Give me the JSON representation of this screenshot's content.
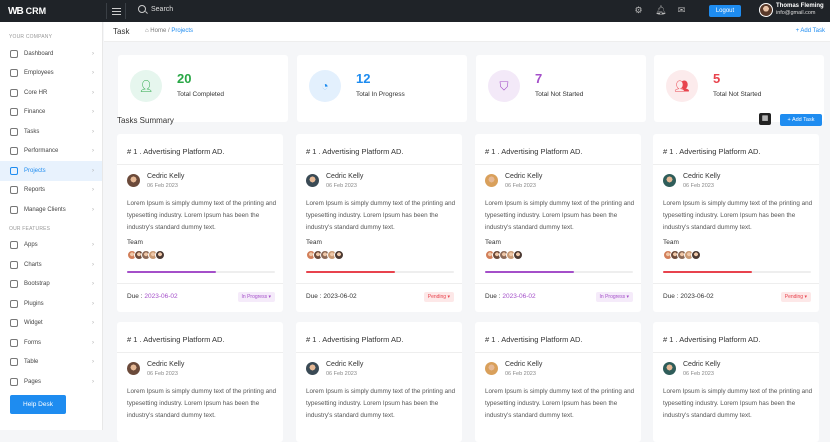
{
  "topbar": {
    "brand": "CRM",
    "brand_mark": "WB",
    "search_label": "Search",
    "logout_label": "Logout",
    "user_name": "Thomas Fleming",
    "user_email": "info@gmail.com"
  },
  "sidebar": {
    "section1": "YOUR COMPANY",
    "items1": [
      "Dashboard",
      "Employees",
      "Core HR",
      "Finance",
      "Tasks",
      "Performance",
      "Projects",
      "Reports",
      "Manage Clients"
    ],
    "section2": "OUR FEATURES",
    "items2": [
      "Apps",
      "Charts",
      "Bootstrap",
      "Plugins",
      "Widget",
      "Forms",
      "Table",
      "Pages"
    ],
    "help_label": "Help Desk"
  },
  "page": {
    "title": "Task",
    "crumb_home": "Home",
    "crumb_sep": "/",
    "crumb_current": "Projects",
    "add_task_link": "+ Add Task"
  },
  "stats": [
    {
      "value": "20",
      "label": "Total Completed",
      "color": "#28a745",
      "bg": "#e6f6ee"
    },
    {
      "value": "12",
      "label": "Total In Progress",
      "color": "#1e8cf0",
      "bg": "#e3f0fd"
    },
    {
      "value": "7",
      "label": "Total Not Started",
      "color": "#a44fc9",
      "bg": "#f3e9f8"
    },
    {
      "value": "5",
      "label": "Total Not Started",
      "color": "#e8434d",
      "bg": "#fcebec"
    }
  ],
  "summary": {
    "title": "Tasks Summary",
    "add_label": "+ Add Task"
  },
  "cards": [
    {
      "title": "# 1 . Advertising Platform AD.",
      "name": "Cedric Kelly",
      "date": "06 Feb 2023",
      "desc": "Lorem Ipsum is simply dummy text of the printing and typesetting industry. Lorem Ipsum has been the industry's standard dummy text.",
      "team": "Team",
      "due_label": "Due :",
      "due": "2023-06-02",
      "status": "In Progress",
      "progress": 0.6,
      "color": "#a44fc9"
    },
    {
      "title": "# 1 . Advertising Platform AD.",
      "name": "Cedric Kelly",
      "date": "06 Feb 2023",
      "desc": "Lorem Ipsum is simply dummy text of the printing and typesetting industry. Lorem Ipsum has been the industry's standard dummy text.",
      "team": "Team",
      "due_label": "Due :",
      "due": "2023-06-02",
      "status": "Pending",
      "progress": 0.6,
      "color": "#e8434d"
    },
    {
      "title": "# 1 . Advertising Platform AD.",
      "name": "Cedric Kelly",
      "date": "06 Feb 2023",
      "desc": "Lorem Ipsum is simply dummy text of the printing and typesetting industry. Lorem Ipsum has been the industry's standard dummy text.",
      "team": "Team",
      "due_label": "Due :",
      "due": "2023-06-02",
      "status": "In Progress",
      "progress": 0.6,
      "color": "#a44fc9"
    },
    {
      "title": "# 1 . Advertising Platform AD.",
      "name": "Cedric Kelly",
      "date": "06 Feb 2023",
      "desc": "Lorem Ipsum is simply dummy text of the printing and typesetting industry. Lorem Ipsum has been the industry's standard dummy text.",
      "team": "Team",
      "due_label": "Due :",
      "due": "2023-06-02",
      "status": "Pending",
      "progress": 0.6,
      "color": "#e8434d"
    },
    {
      "title": "# 1 . Advertising Platform AD.",
      "name": "Cedric Kelly",
      "date": "06 Feb 2023",
      "desc": "Lorem Ipsum is simply dummy text of the printing and typesetting industry. Lorem Ipsum has been the industry's standard dummy text."
    },
    {
      "title": "# 1 . Advertising Platform AD.",
      "name": "Cedric Kelly",
      "date": "06 Feb 2023",
      "desc": "Lorem Ipsum is simply dummy text of the printing and typesetting industry. Lorem Ipsum has been the industry's standard dummy text."
    },
    {
      "title": "# 1 . Advertising Platform AD.",
      "name": "Cedric Kelly",
      "date": "06 Feb 2023",
      "desc": "Lorem Ipsum is simply dummy text of the printing and typesetting industry. Lorem Ipsum has been the industry's standard dummy text."
    },
    {
      "title": "# 1 . Advertising Platform AD.",
      "name": "Cedric Kelly",
      "date": "06 Feb 2023",
      "desc": "Lorem Ipsum is simply dummy text of the printing and typesetting industry. Lorem Ipsum has been the industry's standard dummy text."
    }
  ]
}
